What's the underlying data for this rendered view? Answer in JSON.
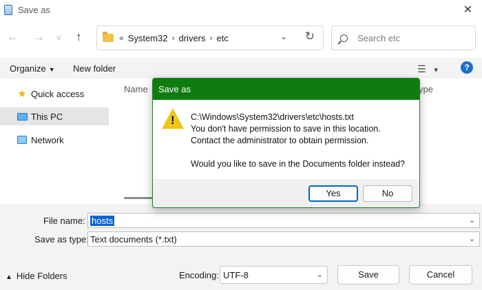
{
  "window": {
    "title": "Save as",
    "close_glyph": "✕"
  },
  "nav": {
    "back_glyph": "←",
    "forward_glyph": "→",
    "recent_glyph": "˅",
    "up_glyph": "↑"
  },
  "address": {
    "prefix": "«",
    "crumbs": [
      "System32",
      "drivers",
      "etc"
    ],
    "sep": "›",
    "chevron": "⌄",
    "refresh": "↻"
  },
  "search": {
    "placeholder": "Search etc"
  },
  "toolbar": {
    "organize_label": "Organize",
    "caret": "▼",
    "new_folder_label": "New folder",
    "view_glyph": "☰",
    "view_caret": "▾",
    "help_glyph": "?"
  },
  "sidebar": {
    "items": [
      {
        "label": "Quick access",
        "icon": "star-icon"
      },
      {
        "label": "This PC",
        "icon": "computer-icon"
      },
      {
        "label": "Network",
        "icon": "network-icon"
      }
    ]
  },
  "filepane": {
    "col_name": "Name",
    "col_type": "ype"
  },
  "form": {
    "file_name_label": "File name:",
    "file_name_value": "hosts",
    "save_type_label": "Save as type:",
    "save_type_value": "Text documents (*.txt)",
    "chev": "⌄",
    "hide_folders_caret": "▲",
    "hide_folders_label": "Hide Folders",
    "encoding_label": "Encoding:",
    "encoding_value": "UTF-8",
    "save_label": "Save",
    "cancel_label": "Cancel"
  },
  "dialog": {
    "title": "Save as",
    "warn_mark": "!",
    "line1": "C:\\Windows\\System32\\drivers\\etc\\hosts.txt",
    "line2": "You don't have permission to save in this location.",
    "line3": "Contact the administrator to obtain permission.",
    "line4": "Would you like to save in the Documents folder instead?",
    "yes_label": "Yes",
    "no_label": "No"
  },
  "colors": {
    "dialog_title_bg": "#107c10",
    "warning": "#f0c419",
    "selection": "#0a64d8",
    "help": "#1f6fd1"
  }
}
